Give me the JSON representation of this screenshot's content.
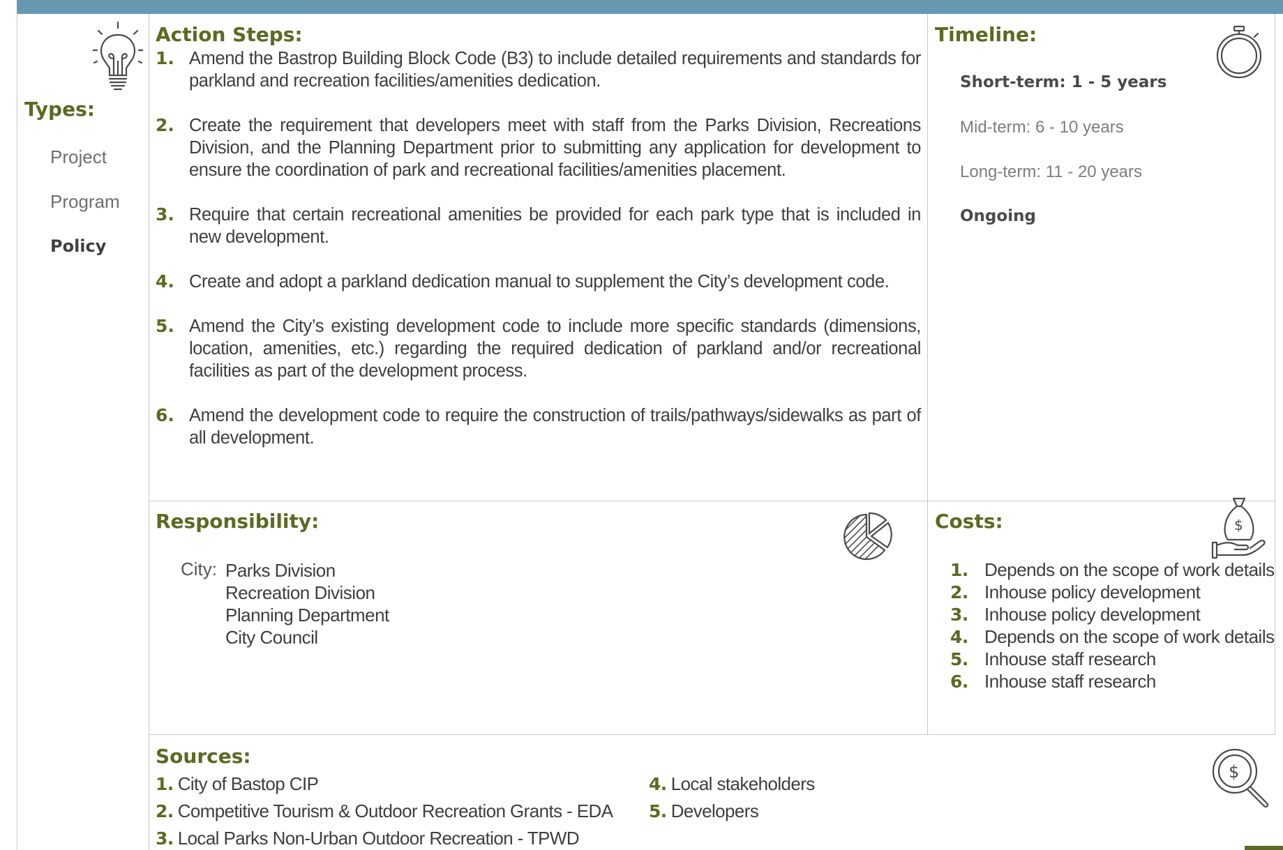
{
  "headings": {
    "types": "Types:",
    "action_steps": "Action Steps:",
    "timeline": "Timeline:",
    "responsibility": "Responsibility:",
    "costs": "Costs:",
    "sources": "Sources:"
  },
  "types": [
    "Project",
    "Program",
    "Policy"
  ],
  "types_active": "Policy",
  "action_steps": [
    {
      "num": "1.",
      "text": "Amend the Bastrop Building Block Code (B3) to include detailed requirements and standards for parkland and recreation facilities/amenities dedication."
    },
    {
      "num": "2.",
      "text": "Create the requirement that developers meet with staff from the Parks Division, Recreations Division, and the Planning Department prior to submitting any application for development to ensure the coordination of park and recreational facilities/amenities placement."
    },
    {
      "num": "3.",
      "text": "Require that certain recreational amenities be provided for each park type that is included in new development."
    },
    {
      "num": "4.",
      "text": "Create and adopt a parkland dedication manual to supplement the City’s development code."
    },
    {
      "num": "5.",
      "text": "Amend the City’s existing development code to include more specific standards (dimensions, location, amenities, etc.) regarding the required dedication of parkland and/or recreational facilities as part of the development process."
    },
    {
      "num": "6.",
      "text": "Amend the development code to require the construction of trails/pathways/sidewalks as part of all development."
    }
  ],
  "timeline": {
    "short": "Short-term:  1 - 5 years",
    "mid": "Mid-term:  6 - 10 years",
    "long": "Long-term:  11 - 20 years",
    "ongoing": "Ongoing"
  },
  "responsibility": {
    "label": "City:",
    "items": [
      "Parks Division",
      "Recreation Division",
      "Planning Department",
      "City Council"
    ]
  },
  "costs": [
    {
      "num": "1.",
      "text": "Depends on the scope of work details"
    },
    {
      "num": "2.",
      "text": "Inhouse policy development"
    },
    {
      "num": "3.",
      "text": "Inhouse policy development"
    },
    {
      "num": "4.",
      "text": "Depends on the scope of work details"
    },
    {
      "num": "5.",
      "text": "Inhouse staff research"
    },
    {
      "num": "6.",
      "text": "Inhouse staff research"
    }
  ],
  "sources": [
    {
      "num": "1.",
      "text": "City of Bastop CIP"
    },
    {
      "num": "2.",
      "text": "Competitive Tourism & Outdoor Recreation Grants - EDA"
    },
    {
      "num": "3.",
      "text": "Local Parks Non-Urban Outdoor Recreation - TPWD"
    },
    {
      "num": "4.",
      "text": "Local stakeholders"
    },
    {
      "num": "5.",
      "text": "Developers"
    }
  ],
  "icons": {
    "types": "lightbulb-icon",
    "timeline": "stopwatch-icon",
    "responsibility": "pie-chart-icon",
    "costs": "money-bag-hand-icon",
    "sources": "magnifier-dollar-icon"
  },
  "colors": {
    "top_bar": "#6699b1",
    "heading": "#5c6a22",
    "border": "#c8c8c8"
  }
}
